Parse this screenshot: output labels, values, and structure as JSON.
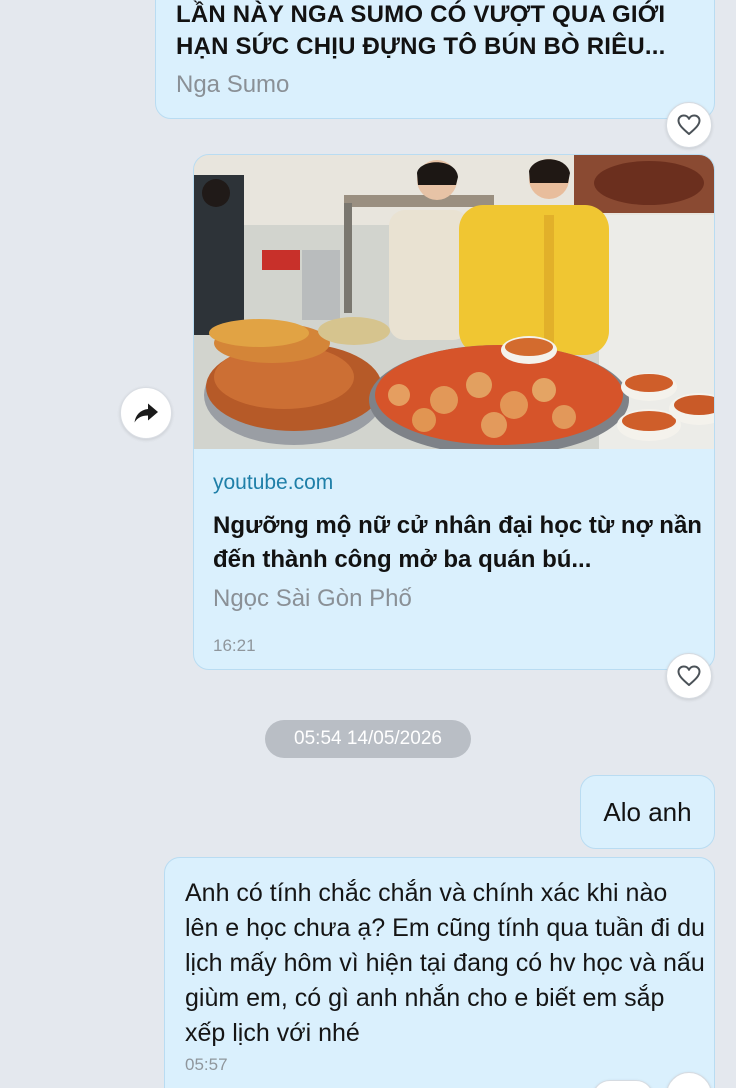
{
  "messages": [
    {
      "type": "link_preview_partial",
      "title": "LẦN NÀY NGA SUMO CÓ VƯỢT QUA GIỚI HẠN SỨC CHỊU ĐỰNG TÔ BÚN BÒ RIÊU...",
      "channel": "Nga Sumo"
    },
    {
      "type": "link_preview",
      "domain": "youtube.com",
      "title": "Ngưỡng mộ nữ cử nhân đại học từ nợ nần đến thành công mở ba quán bú...",
      "channel": "Ngọc Sài Gòn Phố",
      "time": "16:21"
    }
  ],
  "date_separator": "05:54 14/05/2026",
  "outgoing": {
    "text": "Alo anh"
  },
  "incoming": {
    "text": "Anh có tính chắc chắn và chính xác khi nào lên e học chưa ạ? Em cũng tính qua tuần đi du lịch mấy hôm vì hiện tại đang có hv học và nấu giùm em, có gì anh nhắn cho e biết em sắp xếp lịch với nhé",
    "time": "05:57"
  },
  "icons": {
    "react": "heart-outline-icon",
    "share": "share-arrow-icon"
  },
  "colors": {
    "background": "#e4e8ee",
    "bubble": "#daf0fd",
    "link": "#1f7fa8",
    "date_pill": "#b9bec5"
  }
}
